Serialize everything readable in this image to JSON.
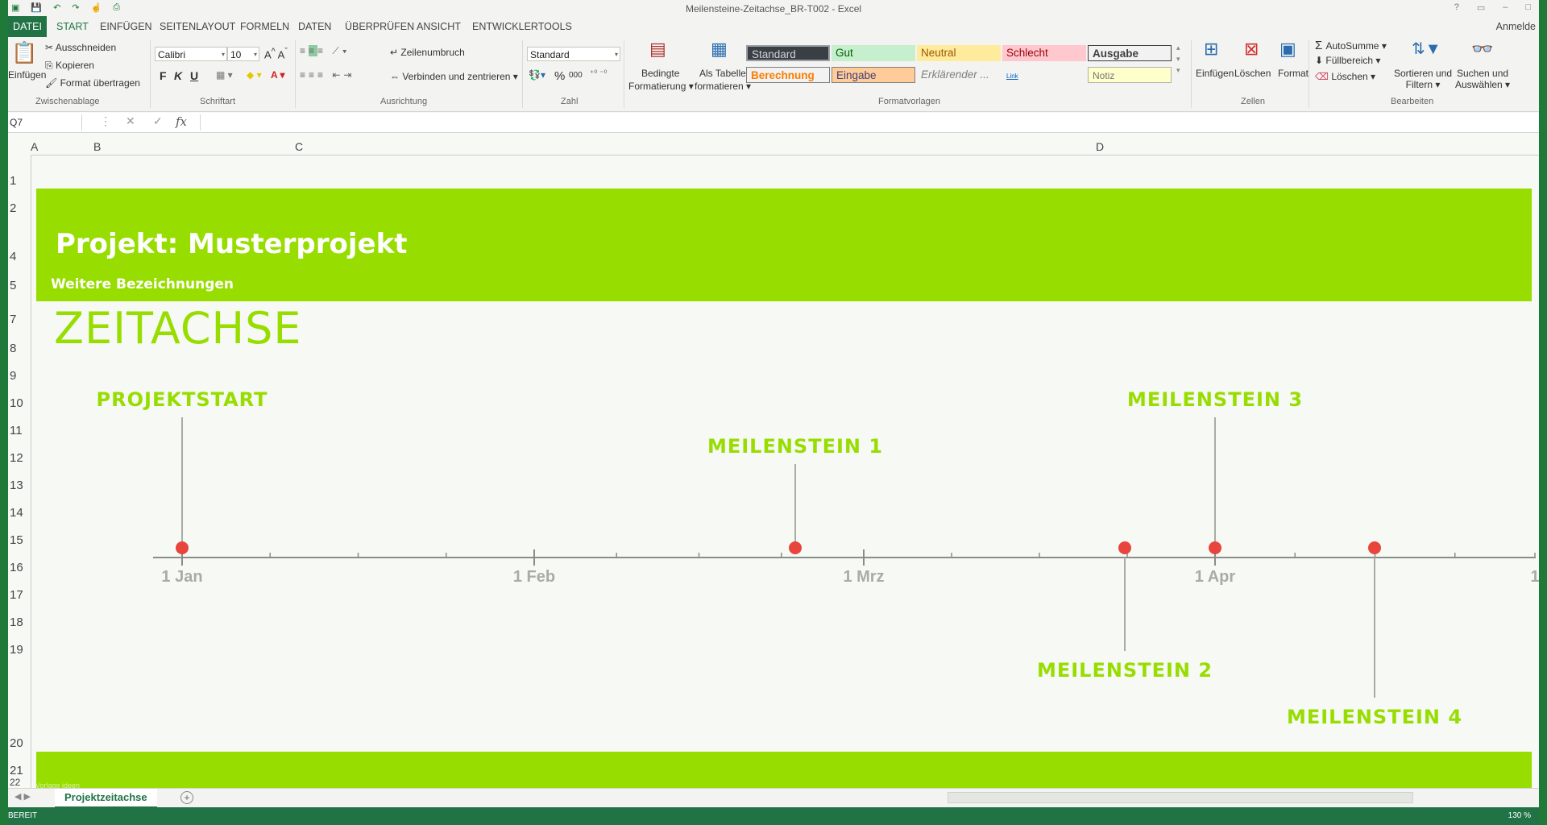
{
  "window": {
    "title": "Meilensteine-Zeitachse_BR-T002 - Excel",
    "user": "Anmelde"
  },
  "ribbon_tabs": [
    "DATEI",
    "START",
    "EINFÜGEN",
    "SEITENLAYOUT",
    "FORMELN",
    "DATEN",
    "ÜBERPRÜFEN",
    "ANSICHT",
    "ENTWICKLERTOOLS"
  ],
  "ribbon": {
    "clipboard": {
      "paste": "Einfügen",
      "cut": "Ausschneiden",
      "copy": "Kopieren",
      "format_painter": "Format übertragen",
      "label": "Zwischenablage"
    },
    "font": {
      "name": "Calibri",
      "size": "10",
      "bold": "F",
      "italic": "K",
      "underline": "U",
      "label": "Schriftart"
    },
    "alignment": {
      "wrap": "Zeilenumbruch",
      "merge": "Verbinden und zentrieren",
      "label": "Ausrichtung"
    },
    "number": {
      "format": "Standard",
      "percent": "%",
      "thousands": "000",
      "label": "Zahl"
    },
    "styles": {
      "conditional": [
        "Bedingte",
        "Formatierung"
      ],
      "as_table": [
        "Als Tabelle",
        "formatieren"
      ],
      "cells": [
        "Standard",
        "Gut",
        "Neutral",
        "Schlecht",
        "Ausgabe",
        "Berechnung",
        "Eingabe",
        "Erklärender ...",
        "Link",
        "Notiz"
      ],
      "label": "Formatvorlagen"
    },
    "cells_group": {
      "insert": "Einfügen",
      "delete": "Löschen",
      "format": "Format",
      "label": "Zellen"
    },
    "editing": {
      "autosum": "AutoSumme",
      "fill": "Füllbereich",
      "clear": "Löschen",
      "sort": [
        "Sortieren und",
        "Filtern"
      ],
      "find": [
        "Suchen und",
        "Auswählen"
      ],
      "label": "Bearbeiten"
    }
  },
  "formula_bar": {
    "name_box": "Q7",
    "fx": "fx",
    "value": ""
  },
  "columns": [
    "A",
    "B",
    "C",
    "D"
  ],
  "rows": [
    "1",
    "2",
    "4",
    "5",
    "7",
    "8",
    "9",
    "10",
    "11",
    "12",
    "13",
    "14",
    "15",
    "16",
    "17",
    "18",
    "19",
    "20",
    "21",
    "22"
  ],
  "sheet": {
    "project_title": "Projekt: Musterprojekt",
    "subtitle": "Weitere Bezeichnungen",
    "heading": "ZEITACHSE",
    "footer": "Vorlage ideen"
  },
  "timeline": {
    "months": [
      "1 Jan",
      "1 Feb",
      "1 Mrz",
      "1 Apr",
      "1"
    ],
    "milestones": [
      {
        "label": "PROJEKTSTART",
        "position": "above"
      },
      {
        "label": "MEILENSTEIN 1",
        "position": "above"
      },
      {
        "label": "MEILENSTEIN 2",
        "position": "below"
      },
      {
        "label": "MEILENSTEIN 3",
        "position": "above"
      },
      {
        "label": "MEILENSTEIN 4",
        "position": "below"
      }
    ],
    "colors": {
      "accent": "#97dd00",
      "marker": "#e8453c",
      "axis": "#8a8d87"
    }
  },
  "sheet_tabs": [
    "Projektzeitachse"
  ],
  "status": {
    "ready": "BEREIT",
    "zoom": "130 %"
  }
}
